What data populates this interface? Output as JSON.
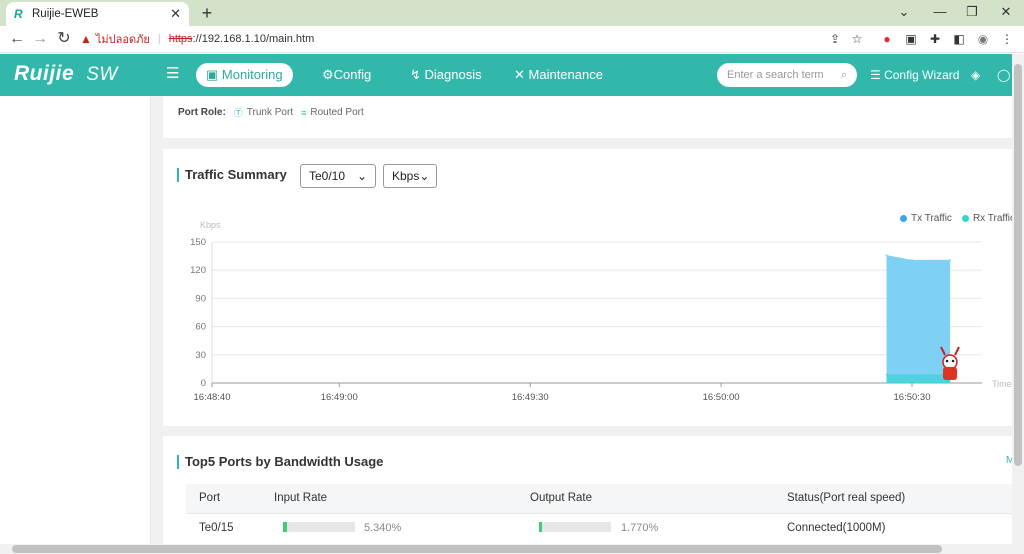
{
  "browser": {
    "tab_title": "Ruijie-EWEB",
    "tab_favicon": "R",
    "new_tab": "+",
    "insecure_label": "ไม่ปลอดภัย",
    "url_scheme": "https",
    "url_rest": "://192.168.1.10/main.htm"
  },
  "app": {
    "logo": "Ruijie",
    "logo_suffix": "SW",
    "nav": [
      {
        "label": "Monitoring"
      },
      {
        "label": "Config"
      },
      {
        "label": "Diagnosis"
      },
      {
        "label": "Maintenance"
      }
    ],
    "search_placeholder": "Enter a search term",
    "config_wizard": "Config Wizard"
  },
  "port_role": {
    "label": "Port Role:",
    "items": [
      "Trunk Port",
      "Routed Port"
    ]
  },
  "traffic": {
    "title": "Traffic Summary",
    "port_select": "Te0/10",
    "unit_select": "Kbps"
  },
  "chart_data": {
    "type": "area",
    "ylabel": "Kbps",
    "xlabel": "Time",
    "ylim": [
      0,
      150
    ],
    "yticks": [
      "150",
      "120",
      "90",
      "60",
      "30",
      "0"
    ],
    "xticks": [
      "16:48:40",
      "16:49:00",
      "16:49:30",
      "16:50:00",
      "16:50:30"
    ],
    "legend": [
      {
        "name": "Tx Traffic",
        "color": "#59c3f2"
      },
      {
        "name": "Rx Traffic",
        "color": "#4fdcc9"
      }
    ],
    "series": [
      {
        "name": "Tx Traffic",
        "x": [
          "16:50:26",
          "16:50:30",
          "16:50:36"
        ],
        "values": [
          136,
          131,
          131
        ]
      },
      {
        "name": "Rx Traffic",
        "x": [
          "16:50:26",
          "16:50:30",
          "16:50:36"
        ],
        "values": [
          9,
          9,
          9
        ]
      }
    ]
  },
  "top5": {
    "title": "Top5 Ports by Bandwidth Usage",
    "more": "M",
    "columns": [
      "Port",
      "Input Rate",
      "Output Rate",
      "Status(Port real speed)"
    ],
    "rows": [
      {
        "port": "Te0/15",
        "input": "5.340%",
        "input_value": 0.0534,
        "output": "1.770%",
        "output_value": 0.0177,
        "status": "Connected(1000M)"
      }
    ]
  }
}
